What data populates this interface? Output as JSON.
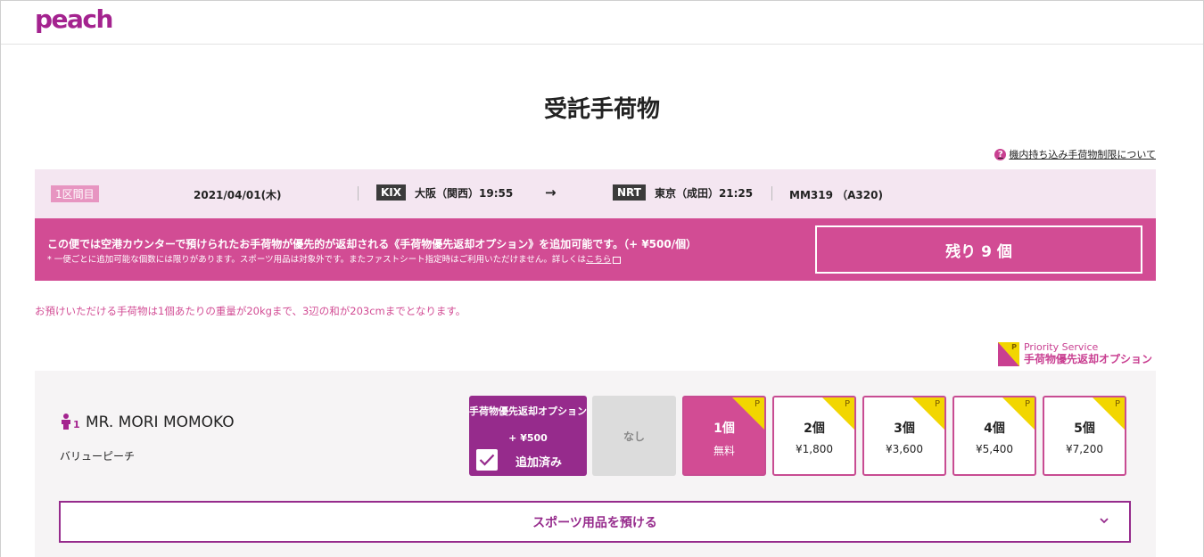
{
  "header": {
    "logo_text": "peach"
  },
  "page": {
    "title": "受託手荷物",
    "help_link": "機内持ち込み手荷物制限について",
    "help_icon": "?"
  },
  "flight": {
    "segment_badge": "1区間目",
    "date": "2021/04/01(木)",
    "from_code": "KIX",
    "from_name": "大阪（関西）19:55",
    "arrow": "→",
    "to_code": "NRT",
    "to_name": "東京（成田）21:25",
    "flight_no": "MM319 （A320)"
  },
  "priority_banner": {
    "main": "この便では空港カウンターで預けられたお手荷物が優先的が返却される《手荷物優先返却オプション》を追加可能です。（+ ¥500/個）",
    "sub": "* 一便ごとに追加可能な個数には限りがあります。スポーツ用品は対象外です。またファストシート指定時はご利用いただけません。詳しくは",
    "sub_link": "こちら",
    "remaining": "残り 9 個"
  },
  "weight_note": "お預けいただける手荷物は1個あたりの重量が20kgまで、3辺の和が203cmまでとなります。",
  "legend": {
    "icon_letter": "P",
    "en": "Priority Service",
    "ja": "手荷物優先返却オプション"
  },
  "passenger": {
    "index": "1",
    "name": "MR. MORI MOMOKO",
    "fare": "バリューピーチ",
    "priority_option": {
      "title": "手荷物優先返却オプション",
      "price": "+ ¥500",
      "status": "追加済み",
      "checked": true
    },
    "none_label": "なし",
    "bag_options": [
      {
        "count": "1個",
        "price": "無料",
        "selected": true
      },
      {
        "count": "2個",
        "price": "¥1,800",
        "selected": false
      },
      {
        "count": "3個",
        "price": "¥3,600",
        "selected": false
      },
      {
        "count": "4個",
        "price": "¥5,400",
        "selected": false
      },
      {
        "count": "5個",
        "price": "¥7,200",
        "selected": false
      }
    ],
    "sports_label": "スポーツ用品を預ける"
  },
  "colors": {
    "brand": "#a4238f",
    "accent_pink": "#d24c94",
    "priority_purple": "#962b8c",
    "flight_bar_bg": "#f4e6f1",
    "corner_yellow": "#f2d600"
  }
}
